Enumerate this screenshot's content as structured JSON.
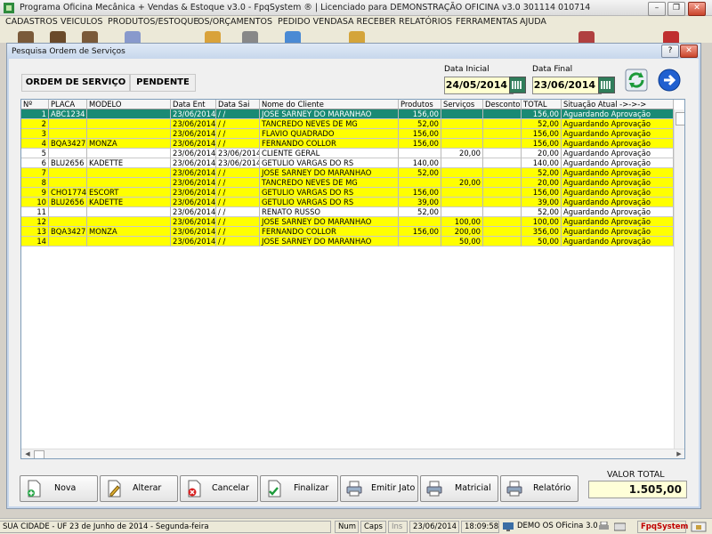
{
  "window": {
    "title": "Programa Oficina Mecânica + Vendas & Estoque v3.0 - FpqSystem ® | Licenciado para  DEMONSTRAÇÃO OFICINA v3.0 301114 010714",
    "min": "–",
    "max": "❐",
    "close": "✕"
  },
  "menu": [
    "CADASTROS",
    "VEICULOS",
    "PRODUTOS/ESTOQUE",
    "OS/ORÇAMENTOS",
    "PEDIDO VENDAS",
    "A RECEBER",
    "RELATÓRIOS",
    "FERRAMENTAS",
    "AJUDA"
  ],
  "dialog": {
    "title": "Pesquisa Ordem de Serviços",
    "help": "?",
    "close": "✕",
    "tabs": [
      "ORDEM DE SERVIÇO",
      "PENDENTE"
    ],
    "date_start_label": "Data Inicial",
    "date_start": "24/05/2014",
    "date_end_label": "Data Final",
    "date_end": "23/06/2014"
  },
  "grid": {
    "columns": [
      "Nº",
      "PLACA",
      "MODELO",
      "Data Ent",
      "Data Sai",
      "Nome do Cliente",
      "Produtos",
      "Serviços",
      "Desconto",
      "TOTAL",
      "Situação Atual ->->->"
    ],
    "rows": [
      {
        "c": [
          "1",
          "ABC1234",
          "",
          "23/06/2014",
          " /  /",
          "JOSE SARNEY DO MARANHAO",
          "156,00",
          "",
          "",
          "156,00",
          "Aguardando Aprovação"
        ],
        "bg": "#1a8a74",
        "fg": "#ffffff"
      },
      {
        "c": [
          "2",
          "",
          "",
          "23/06/2014",
          " /  /",
          "TANCREDO NEVES DE MG",
          "52,00",
          "",
          "",
          "52,00",
          "Aguardando Aprovação"
        ],
        "bg": "#ffff00",
        "fg": "#000000"
      },
      {
        "c": [
          "3",
          "",
          "",
          "23/06/2014",
          " /  /",
          "FLAVIO QUADRADO",
          "156,00",
          "",
          "",
          "156,00",
          "Aguardando Aprovação"
        ],
        "bg": "#ffff00",
        "fg": "#000000"
      },
      {
        "c": [
          "4",
          "BQA3427",
          "MONZA",
          "23/06/2014",
          " /  /",
          "FERNANDO COLLOR",
          "156,00",
          "",
          "",
          "156,00",
          "Aguardando Aprovação"
        ],
        "bg": "#ffff00",
        "fg": "#000000"
      },
      {
        "c": [
          "5",
          "",
          "",
          "23/06/2014",
          "23/06/2014",
          "CLIENTE GERAL",
          "",
          "20,00",
          "",
          "20,00",
          "Aguardando Aprovação"
        ],
        "bg": "#ffffff",
        "fg": "#000000"
      },
      {
        "c": [
          "6",
          "BLU2656",
          "KADETTE",
          "23/06/2014",
          "23/06/2014",
          "GETULIO VARGAS DO RS",
          "140,00",
          "",
          "",
          "140,00",
          "Aguardando Aprovação"
        ],
        "bg": "#ffffff",
        "fg": "#000000"
      },
      {
        "c": [
          "7",
          "",
          "",
          "23/06/2014",
          " /  /",
          "JOSE SARNEY DO MARANHAO",
          "52,00",
          "",
          "",
          "52,00",
          "Aguardando Aprovação"
        ],
        "bg": "#ffff00",
        "fg": "#000000"
      },
      {
        "c": [
          "8",
          "",
          "",
          "23/06/2014",
          " /  /",
          "TANCREDO NEVES DE MG",
          "",
          "20,00",
          "",
          "20,00",
          "Aguardando Aprovação"
        ],
        "bg": "#ffff00",
        "fg": "#000000"
      },
      {
        "c": [
          "9",
          "CHO1774",
          "ESCORT",
          "23/06/2014",
          " /  /",
          "GETULIO VARGAS DO RS",
          "156,00",
          "",
          "",
          "156,00",
          "Aguardando Aprovação"
        ],
        "bg": "#ffff00",
        "fg": "#000000"
      },
      {
        "c": [
          "10",
          "BLU2656",
          "KADETTE",
          "23/06/2014",
          " /  /",
          "GETULIO VARGAS DO RS",
          "39,00",
          "",
          "",
          "39,00",
          "Aguardando Aprovação"
        ],
        "bg": "#ffff00",
        "fg": "#000000"
      },
      {
        "c": [
          "11",
          "",
          "",
          "23/06/2014",
          " /  /",
          "RENATO RUSSO",
          "52,00",
          "",
          "",
          "52,00",
          "Aguardando Aprovação"
        ],
        "bg": "#ffffff",
        "fg": "#000000"
      },
      {
        "c": [
          "12",
          "",
          "",
          "23/06/2014",
          " /  /",
          "JOSE SARNEY DO MARANHAO",
          "",
          "100,00",
          "",
          "100,00",
          "Aguardando Aprovação"
        ],
        "bg": "#ffff00",
        "fg": "#000000"
      },
      {
        "c": [
          "13",
          "BQA3427",
          "MONZA",
          "23/06/2014",
          " /  /",
          "FERNANDO COLLOR",
          "156,00",
          "200,00",
          "",
          "356,00",
          "Aguardando Aprovação"
        ],
        "bg": "#ffff00",
        "fg": "#000000"
      },
      {
        "c": [
          "14",
          "",
          "",
          "23/06/2014",
          " /  /",
          "JOSE SARNEY DO MARANHAO",
          "",
          "50,00",
          "",
          "50,00",
          "Aguardando Aprovação"
        ],
        "bg": "#ffff00",
        "fg": "#000000"
      }
    ]
  },
  "buttons": [
    "Nova",
    "Alterar",
    "Cancelar",
    "Finalizar",
    "Emitir Jato",
    "Matricial",
    "Relatório"
  ],
  "total": {
    "label": "VALOR TOTAL",
    "value": "1.505,00"
  },
  "statusbar": [
    "SUA CIDADE - UF 23 de Junho de 2014 - Segunda-feira",
    "Num",
    "Caps",
    "Ins",
    "23/06/2014",
    "18:09:58",
    "DEMO OS OFicina 3.0",
    "FpqSystem"
  ]
}
